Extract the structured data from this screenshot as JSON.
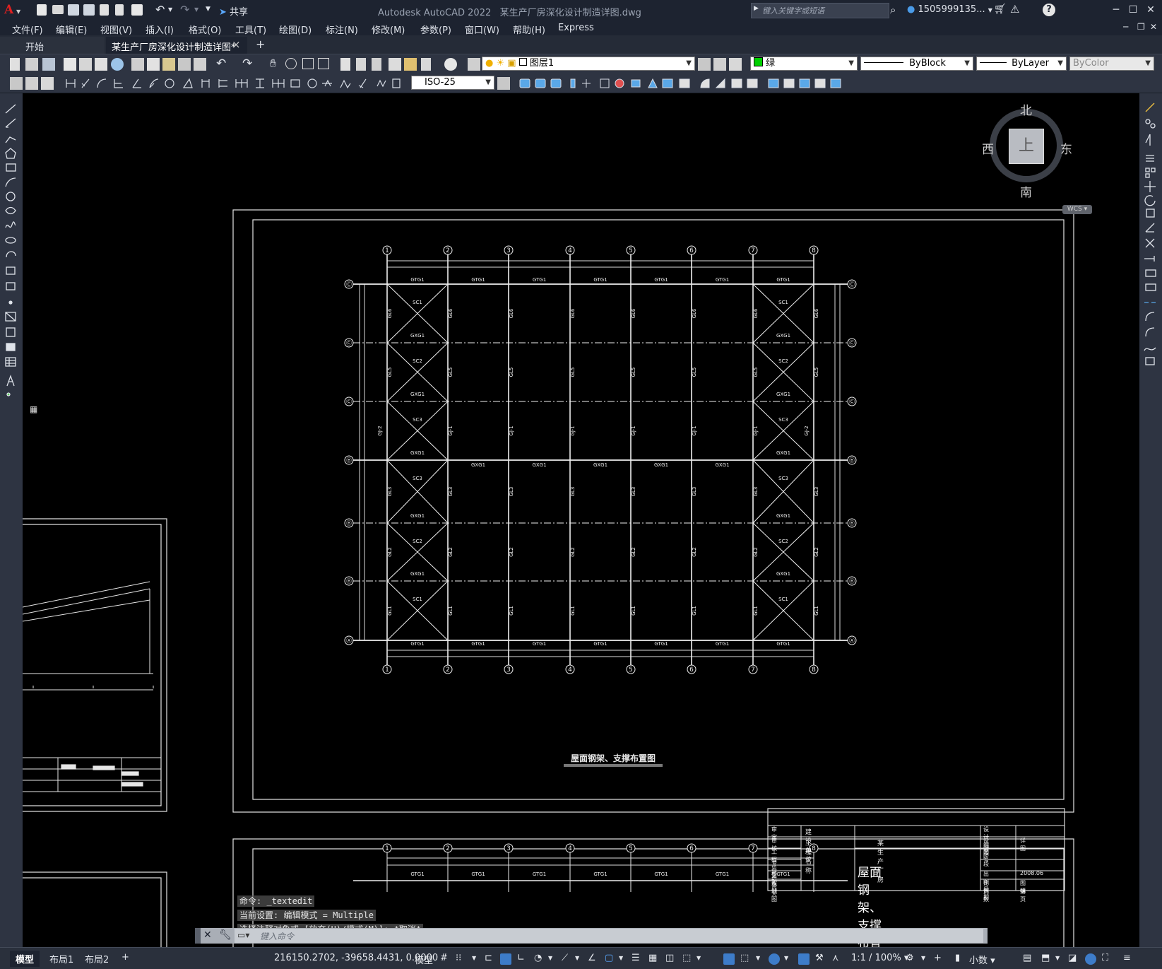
{
  "app": {
    "title": "Autodesk AutoCAD 2022",
    "filename": "某生产厂房深化设计制造详图.dwg",
    "share_label": "共享",
    "search_placeholder": "键入关键字或短语",
    "user": "1505999135...",
    "menu_letter": "A"
  },
  "menu": [
    "文件(F)",
    "编辑(E)",
    "视图(V)",
    "插入(I)",
    "格式(O)",
    "工具(T)",
    "绘图(D)",
    "标注(N)",
    "修改(M)",
    "参数(P)",
    "窗口(W)",
    "帮助(H)",
    "Express"
  ],
  "tabs": {
    "start": "开始",
    "active": "某生产厂房深化设计制造详图*",
    "close": "×",
    "add": "+"
  },
  "toolbar": {
    "layer": "图层1",
    "color": "绿",
    "linetype": "ByBlock",
    "lineweight": "ByLayer",
    "plotstyle": "ByColor",
    "dimstyle": "ISO-25"
  },
  "viewcube": {
    "north": "北",
    "south": "南",
    "west": "西",
    "east": "东",
    "top": "上",
    "wcs": "WCS ▾"
  },
  "drawing": {
    "title": "屋面钢架、支撑布置图",
    "grid_cols": [
      "①",
      "②",
      "③",
      "④",
      "⑤",
      "⑥",
      "⑦",
      "⑧"
    ],
    "grid_rows": [
      "Ⓒ",
      "Ⓒ",
      "Ⓒ",
      "Ⓑ",
      "Ⓑ",
      "Ⓑ",
      "Ⓐ"
    ],
    "brace_labels": [
      "SC1",
      "SC2",
      "SC3",
      "SC3",
      "SC2",
      "SC1"
    ],
    "member_labels": {
      "top_beam": "GTG1",
      "bay_beam": "GXG1",
      "purlin_rows": [
        "GL6",
        "GL5",
        "GJ-1",
        "GL3",
        "GL2",
        "GL1"
      ],
      "gable": "GJ-2"
    },
    "titleblock": {
      "left_rows": [
        "审 定",
        "审 核",
        "工程负责人",
        "专业负责人",
        "校 对",
        "设 计",
        "制 图"
      ],
      "mid_top": [
        [
          "建设单位",
          ""
        ],
        [
          "工程名称",
          "某生产厂房"
        ]
      ],
      "big_title": "屋面钢架、支撑布置图",
      "right_rows": [
        [
          "设计编号",
          ""
        ],
        [
          "设计阶段",
          "详图"
        ],
        [
          "图 号",
          ""
        ],
        [
          "",
          ""
        ],
        [
          "出图日期",
          "2008.06"
        ],
        [
          "比 例",
          "图 幅"
        ],
        [
          "页 数",
          "第 页"
        ]
      ]
    }
  },
  "command": {
    "history": [
      "命令: _textedit",
      "当前设置: 编辑模式 = Multiple",
      "选择注释对象或 [放弃(U)/模式(M)]: *取消*"
    ],
    "placeholder": "键入命令"
  },
  "layouts": [
    "模型",
    "布局1",
    "布局2",
    "+"
  ],
  "status": {
    "coords": "216150.2702, -39658.4431, 0.0000",
    "space": "模型",
    "scale": "1:1 / 100% ▾",
    "units": "小数 ▾"
  }
}
